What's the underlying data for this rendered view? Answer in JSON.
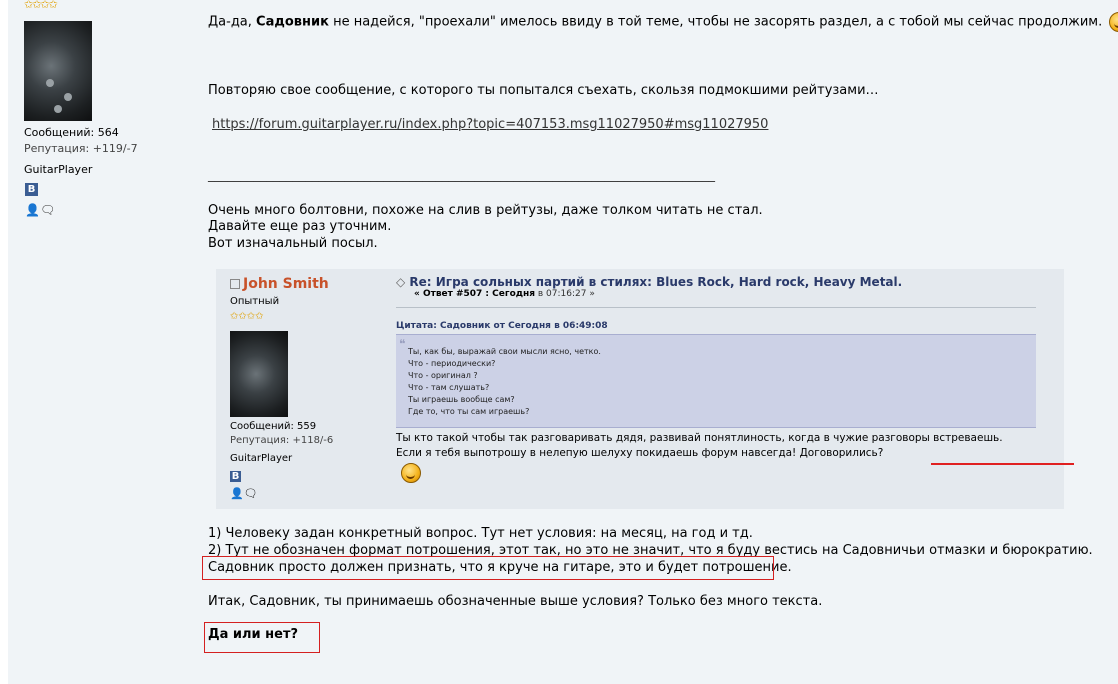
{
  "author": {
    "stars": "✩✩✩✩",
    "posts": "Сообщений: 564",
    "rep": "Репутация: +119/-7",
    "group": "GuitarPlayer",
    "vk_label": "B",
    "profile_icons": "👤🗨"
  },
  "post": {
    "p1_a": "Да-да, ",
    "p1_b": "Садовник",
    "p1_c": " не надейся, \"проехали\" имелось ввиду в той теме, чтобы не засорять раздел, а с тобой мы сейчас продолжим.",
    "p2": "Повторяю свое сообщение, с которого ты попытался съехать, скользя подмокшими рейтузами…",
    "link": "https://forum.guitarplayer.ru/index.php?topic=407153.msg11027950#msg11027950",
    "rule": "______________________________________________________________________________",
    "p3": "Очень много болтовни, похоже на слив в рейтузы, даже толком читать не стал.",
    "p4": "Давайте еще раз уточним.",
    "p5": "Вот изначальный посыл.",
    "l1": "1)   Человеку задан конкретный вопрос. Тут нет условия: на месяц, на год и тд.",
    "l2": "2)   Тут не обозначен формат потрошения, этот так, но это не значит, что я буду вестись на Садовничьи отмазки и бюрократию.",
    "l3": "Садовник просто должен признать, что я круче на гитаре, это и будет потрошение.",
    "p6": "Итак, Садовник, ты принимаешь обозначенные выше условия? Только без много текста.",
    "final": "Да или нет?"
  },
  "quote": {
    "name": "John Smith",
    "rank": "Опытный",
    "stars": "✩✩✩✩",
    "posts": "Сообщений: 559",
    "rep": "Репутация: +118/-6",
    "group": "GuitarPlayer",
    "vk_label": "B",
    "title": "Re: Игра сольных партий в стилях: Blues Rock, Hard rock, Heavy Metal.",
    "meta_a": "« Ответ #507 : Сегодня",
    "meta_b": " в 07:16:27 »",
    "cite": "Цитата: Садовник от Сегодня в 06:49:08",
    "inner": [
      "Ты, как бы, выражай свои мысли ясно, четко.",
      "Что - периодически?",
      "Что - оригинал ?",
      "Что - там слушать?",
      "Ты играешь вообще сам?",
      "Где то, что ты сам играешь?"
    ],
    "reply1": "Ты кто такой чтобы так разговаривать дядя, развивай понятлиность, когда в чужие разговоры встреваешь.",
    "reply2": "Если я тебя выпотрошу в нелепую шелуху покидаешь форум навсегда! Договорились?"
  },
  "colors": {
    "accent": "#c8522a",
    "highlight_border": "#d42020",
    "quote_bg": "#ccd1e6"
  }
}
